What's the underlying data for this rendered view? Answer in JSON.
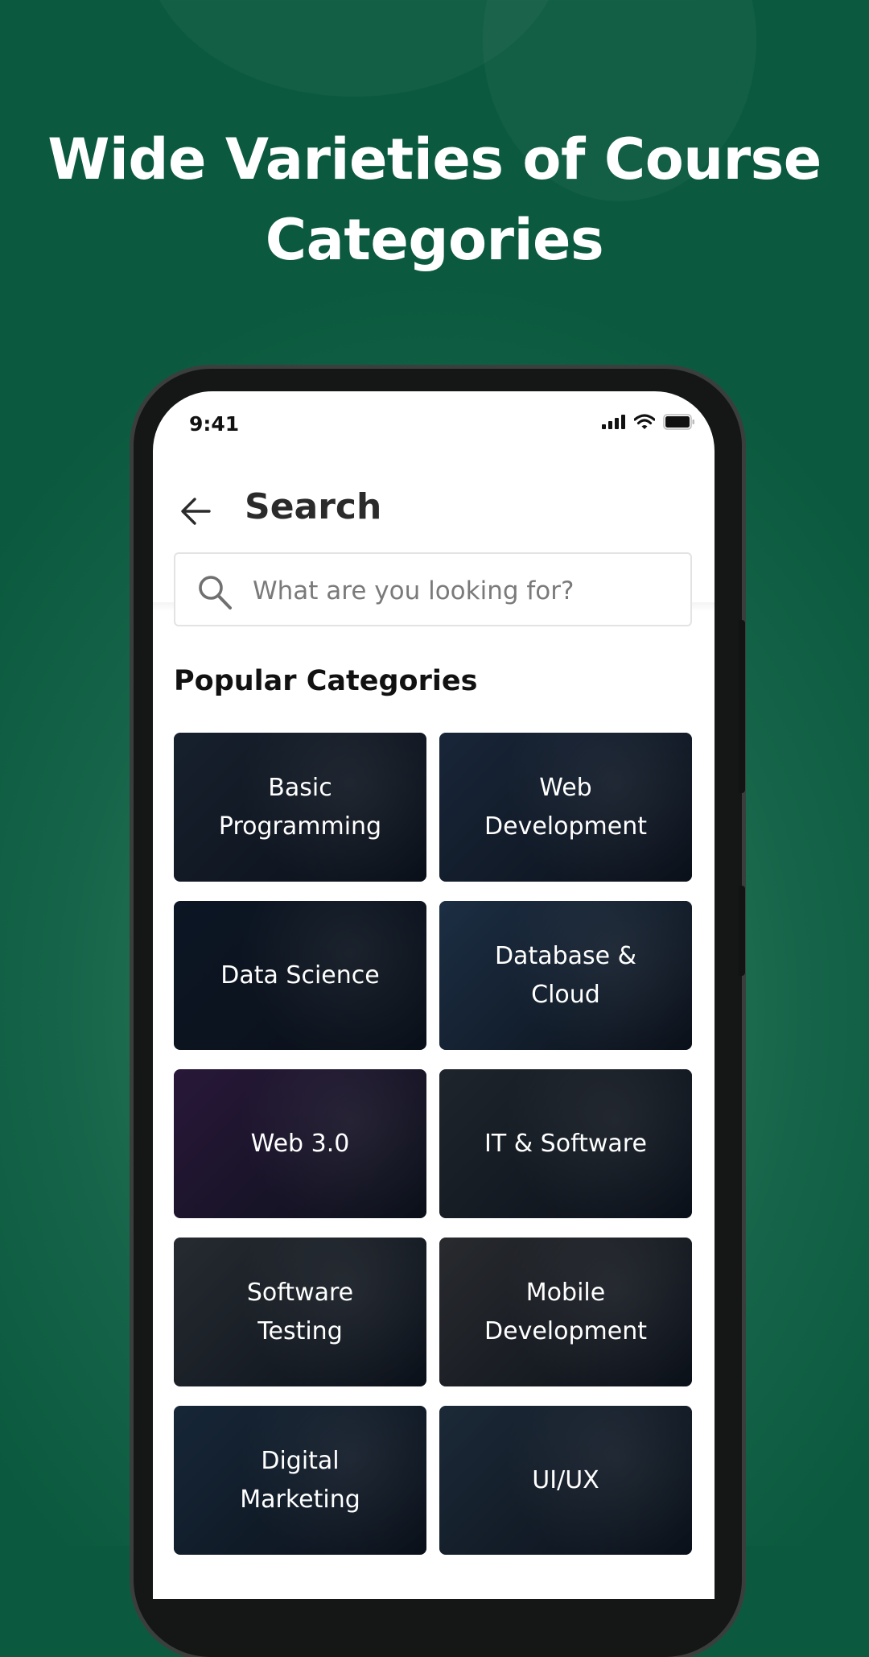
{
  "headline": {
    "line1": "Wide Varieties of Course",
    "line2": "Categories"
  },
  "status_bar": {
    "time": "9:41",
    "icons": [
      "cellular-signal-icon",
      "wifi-icon",
      "battery-icon"
    ]
  },
  "header": {
    "back_icon": "arrow-left-icon",
    "title": "Search"
  },
  "search": {
    "icon": "search-icon",
    "placeholder": "What are you looking for?",
    "value": ""
  },
  "section": {
    "title": "Popular Categories"
  },
  "categories": [
    {
      "label": "Basic\nProgramming",
      "bg": "#1f2a38"
    },
    {
      "label": "Web\nDevelopment",
      "bg": "#22334a"
    },
    {
      "label": "Data Science",
      "bg": "#0f1b2a"
    },
    {
      "label": "Database &\nCloud",
      "bg": "#27405a"
    },
    {
      "label": "Web 3.0",
      "bg": "#3a1d4a"
    },
    {
      "label": "IT & Software",
      "bg": "#2a3136"
    },
    {
      "label": "Software\nTesting",
      "bg": "#363b3e"
    },
    {
      "label": "Mobile\nDevelopment",
      "bg": "#3a3a3a"
    },
    {
      "label": "Digital\nMarketing",
      "bg": "#1f3448"
    },
    {
      "label": "UI/UX",
      "bg": "#263848"
    }
  ],
  "colors": {
    "background_green": "#16654a",
    "phone_frame": "#141716",
    "title_text": "#2b2b2b",
    "placeholder_text": "#7a7a7a"
  }
}
